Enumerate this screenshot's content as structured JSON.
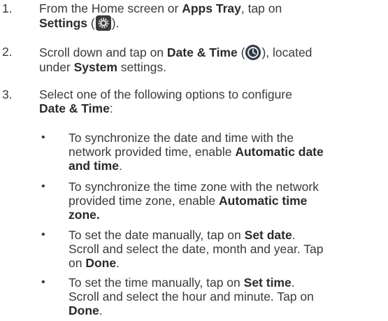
{
  "steps": [
    {
      "number": "1.",
      "line1_before": "From the Home screen or ",
      "line1_bold": "Apps Tray",
      "line1_after": ", tap on",
      "line2_bold": "Settings",
      "line2_open": " (",
      "line2_close": ")."
    },
    {
      "number": "2.",
      "line1_before": "Scroll down and tap on ",
      "line1_bold": "Date & Time",
      "line1_open": " (",
      "line1_close": "), located",
      "line2_before": "under ",
      "line2_bold": "System",
      "line2_after": " settings."
    },
    {
      "number": "3.",
      "line1": "Select one of the following options to configure",
      "line2_bold": "Date & Time",
      "line2_after": ":"
    }
  ],
  "bullets": [
    {
      "symbol": "•",
      "line1": "To synchronize the date and time with the",
      "line2_before": "network provided time, enable ",
      "line2_bold": "Automatic date",
      "line3_bold": "and time",
      "line3_after": "."
    },
    {
      "symbol": "•",
      "line1": "To synchronize the time zone with the network",
      "line2_before": "provided time zone, enable ",
      "line2_bold": "Automatic time",
      "line3_bold": "zone."
    },
    {
      "symbol": "•",
      "line1_before": "To set the date manually, tap on ",
      "line1_bold": "Set date",
      "line1_after": ".",
      "line2": "Scroll and select the date, month and year. Tap",
      "line3_before": "on ",
      "line3_bold": "Done",
      "line3_after": "."
    },
    {
      "symbol": "•",
      "line1_before": "To set the time manually, tap on ",
      "line1_bold": "Set time",
      "line1_after": ".",
      "line2": "Scroll and select the hour and minute. Tap on",
      "line3_bold": "Done",
      "line3_after": "."
    }
  ],
  "icons": {
    "settings": "gear-icon",
    "date_time": "clock-icon"
  },
  "colors": {
    "text": "#3a3a3a",
    "gear_bg": "#3b3b3b",
    "clock_bg": "#2f3a44"
  }
}
